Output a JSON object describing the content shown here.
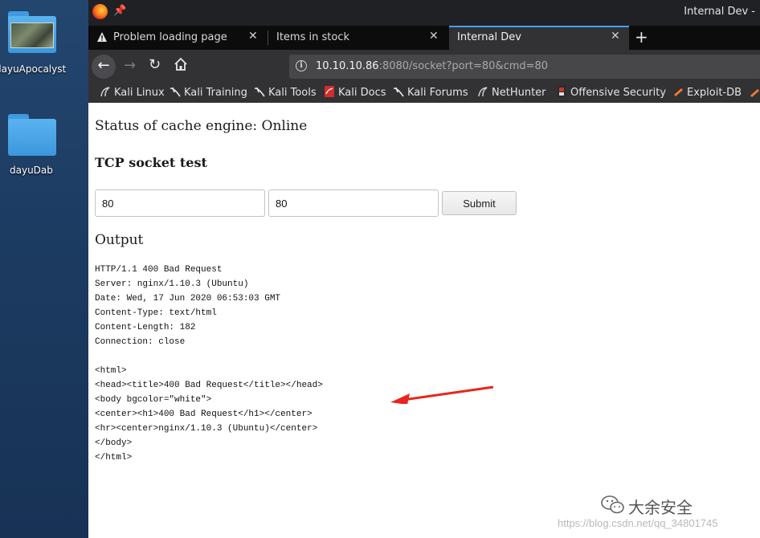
{
  "desktop": {
    "icons": [
      {
        "label": "dayuApocalyst"
      },
      {
        "label": "dayuDab"
      }
    ]
  },
  "window": {
    "title": "Internal Dev -"
  },
  "tabs": [
    {
      "label": "Problem loading page"
    },
    {
      "label": "Items in stock"
    },
    {
      "label": "Internal Dev"
    }
  ],
  "url": {
    "host": "10.10.10.86",
    "rest": ":8080/socket?port=80&cmd=80"
  },
  "bookmarks": [
    {
      "label": "Kali Linux"
    },
    {
      "label": "Kali Training"
    },
    {
      "label": "Kali Tools"
    },
    {
      "label": "Kali Docs"
    },
    {
      "label": "Kali Forums"
    },
    {
      "label": "NetHunter"
    },
    {
      "label": "Offensive Security"
    },
    {
      "label": "Exploit-DB"
    }
  ],
  "page": {
    "status": "Status of cache engine: Online",
    "tcp_heading": "TCP socket test",
    "port_value": "80",
    "cmd_value": "80",
    "submit_label": "Submit",
    "output_heading": "Output",
    "output_text": "HTTP/1.1 400 Bad Request\nServer: nginx/1.10.3 (Ubuntu)\nDate: Wed, 17 Jun 2020 06:53:03 GMT\nContent-Type: text/html\nContent-Length: 182\nConnection: close\n\n<html>\n<head><title>400 Bad Request</title></head>\n<body bgcolor=\"white\">\n<center><h1>400 Bad Request</h1></center>\n<hr><center>nginx/1.10.3 (Ubuntu)</center>\n</body>\n</html>"
  },
  "watermark": {
    "brand": "大余安全",
    "url": "https://blog.csdn.net/qq_34801745"
  },
  "colors": {
    "accent": "#45a1ff",
    "annotation_arrow": "#e8251e"
  }
}
